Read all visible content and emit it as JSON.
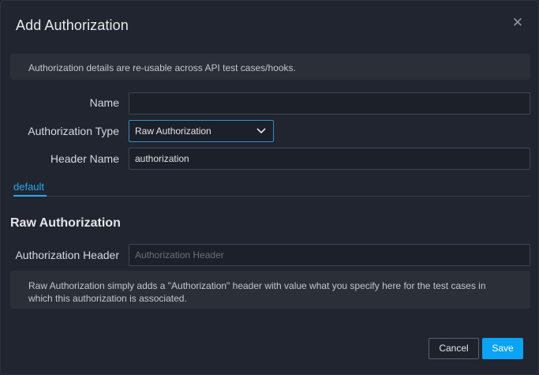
{
  "dialog": {
    "title": "Add Authorization",
    "close_icon": "close-icon"
  },
  "info_top": "Authorization details are re-usable across API test cases/hooks.",
  "form": {
    "name_label": "Name",
    "name_value": "",
    "auth_type_label": "Authorization Type",
    "auth_type_value": "Raw Authorization",
    "header_name_label": "Header Name",
    "header_name_value": "authorization"
  },
  "tabs": [
    {
      "label": "default",
      "active": true
    }
  ],
  "section": {
    "title": "Raw Authorization",
    "auth_header_label": "Authorization Header",
    "auth_header_placeholder": "Authorization Header",
    "auth_header_value": ""
  },
  "info_bottom": "Raw Authorization simply adds a \"Authorization\" header with value what you specify here for the test cases in which this authorization is associated.",
  "buttons": {
    "cancel": "Cancel",
    "save": "Save"
  },
  "colors": {
    "accent": "#2ea6f0",
    "primary_button": "#0aa3f5",
    "background": "#202530"
  }
}
